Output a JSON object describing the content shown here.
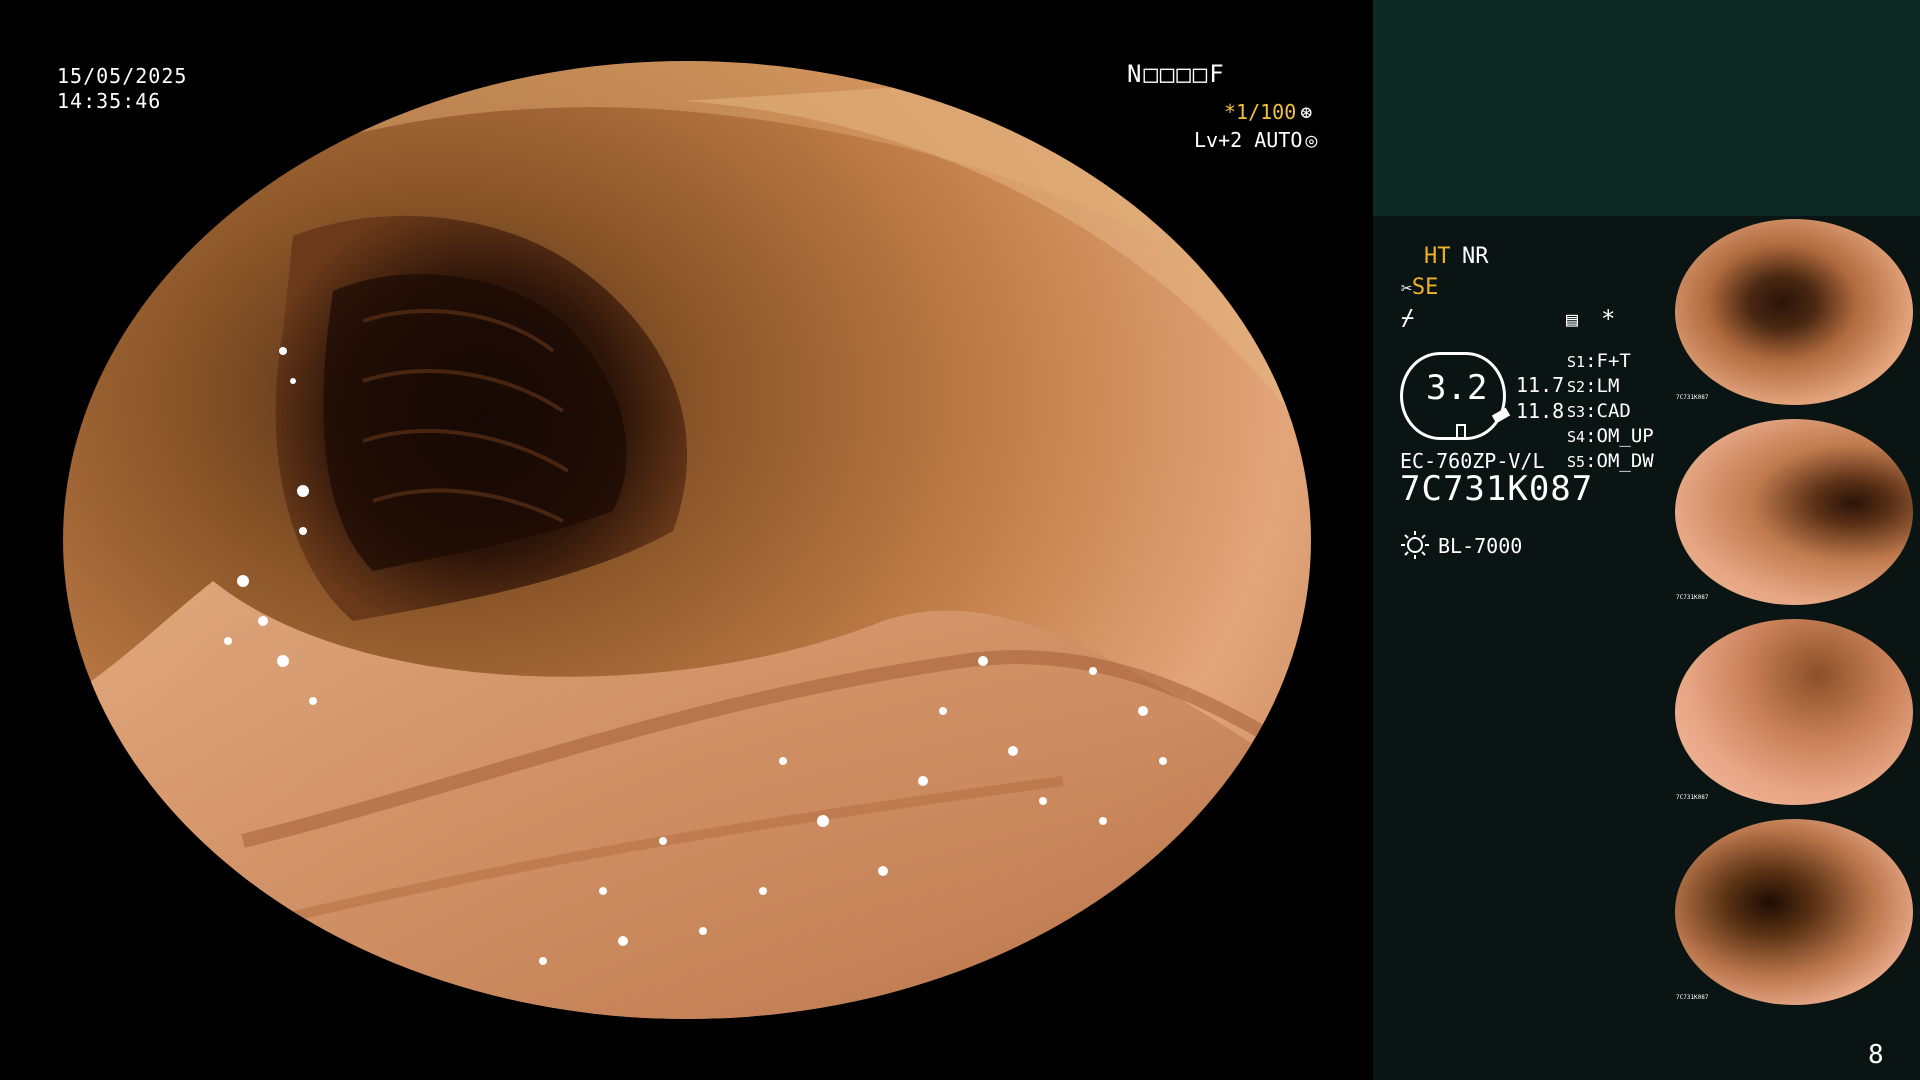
{
  "overlay": {
    "date": "15/05/2025",
    "time": "14:35:46",
    "patient_code": "N□□□□F",
    "shutter": "*1/100",
    "level": "Lv+2 AUTO"
  },
  "panel": {
    "ht": "HT",
    "nr": "NR",
    "se": "SE",
    "dial_value": "3.2",
    "values": [
      "11.7",
      "11.8"
    ],
    "switches": [
      {
        "key": "S1",
        "label": "F+T"
      },
      {
        "key": "S2",
        "label": "LM"
      },
      {
        "key": "S3",
        "label": "CAD"
      },
      {
        "key": "S4",
        "label": "OM_UP"
      },
      {
        "key": "S5",
        "label": "OM_DW"
      }
    ],
    "scope_model": "EC-760ZP-V/L",
    "serial": "7C731K087",
    "light_source": "BL-7000",
    "star": "*",
    "page_number": "8"
  },
  "thumbnails": {
    "serial_small": "7C731K087",
    "count": 4
  },
  "colors": {
    "accent_yellow": "#f0b12a",
    "panel_bg": "#0a1513",
    "panel_top": "#0f2a25"
  },
  "icons": [
    "shutter-icon",
    "auto-icon",
    "scissors-icon",
    "flash-off-icon",
    "memo-icon",
    "light-source-icon"
  ]
}
